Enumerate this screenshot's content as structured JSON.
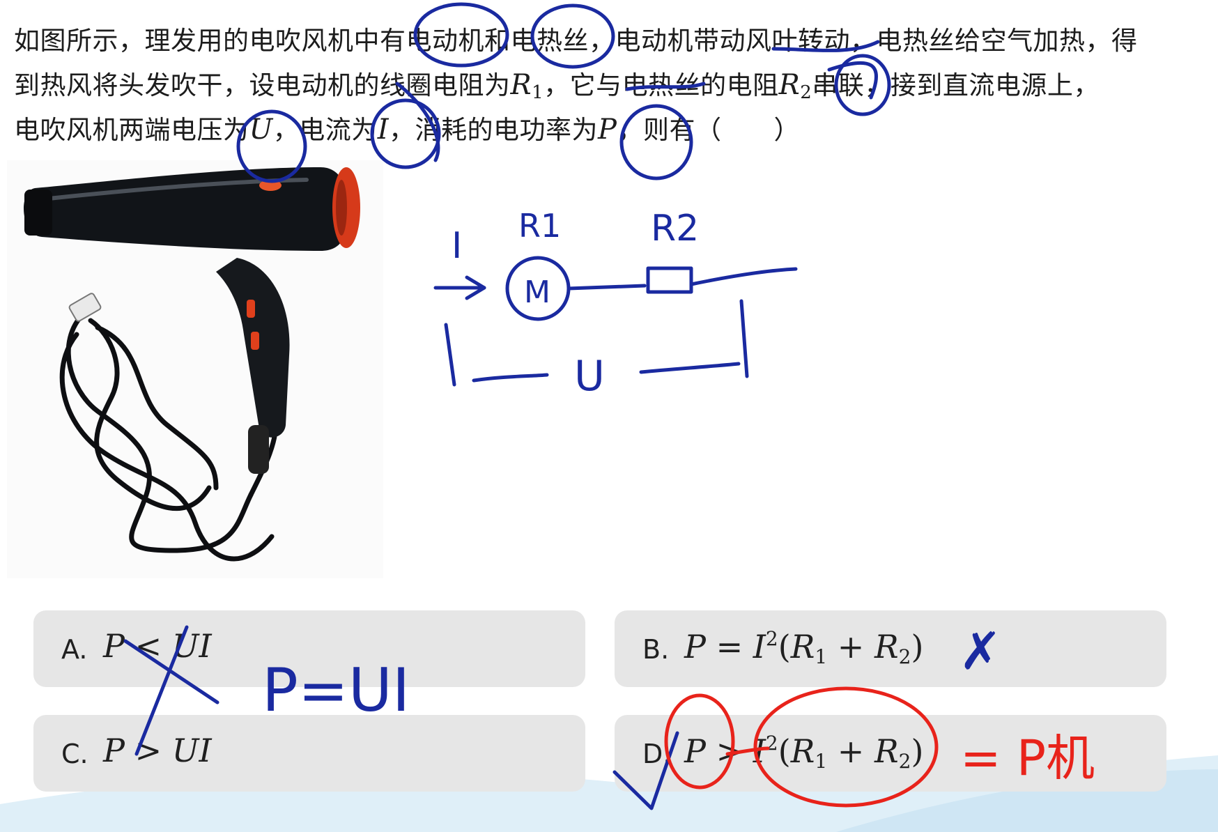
{
  "question": {
    "line1": "如图所示，理发用的电吹风机中有电动机和电热丝，电动机带动风叶转动，电热丝给空气加热，得",
    "line2_a": "到热风将头发吹干，设电动机的线圈电阻为",
    "line2_r1": "R",
    "line2_r1_sub": "1",
    "line2_b": "，它与电热丝的电阻",
    "line2_r2": "R",
    "line2_r2_sub": "2",
    "line2_c": "串联，接到直流电源上，",
    "line3_a": "电吹风机两端电压为",
    "line3_u": "U",
    "line3_b": "，电流为",
    "line3_i": "I",
    "line3_c": "，消耗的电功率为",
    "line3_p": "P",
    "line3_d": "，则有（　　）"
  },
  "options": [
    {
      "letter": "A.",
      "p": "P",
      "op": "<",
      "rhs": "UI"
    },
    {
      "letter": "B.",
      "p": "P",
      "op": "=",
      "i": "I",
      "exp": "2",
      "lp": "(",
      "r1": "R",
      "s1": "1",
      "plus": "+",
      "r2": "R",
      "s2": "2",
      "rp": ")"
    },
    {
      "letter": "C.",
      "p": "P",
      "op": ">",
      "rhs": "UI"
    },
    {
      "letter": "D.",
      "p": "P",
      "op": ">",
      "i": "I",
      "exp": "2",
      "lp": "(",
      "r1": "R",
      "s1": "1",
      "plus": "+",
      "r2": "R",
      "s2": "2",
      "rp": ")"
    }
  ],
  "handwriting": {
    "current": "I",
    "r1": "R1",
    "r2": "R2",
    "motor": "M",
    "voltage": "U",
    "note_a": "P=UI",
    "note_d": "= P机",
    "mark_b": "✗",
    "mark_d": "✓"
  },
  "colors": {
    "ink_blue": "#1a2aa0",
    "ink_red": "#e8231b",
    "option_bg": "#e6e6e6",
    "dryer_body": "#15181c",
    "dryer_accent": "#e0401c"
  },
  "image": {
    "icon": "hair-dryer-photo"
  }
}
